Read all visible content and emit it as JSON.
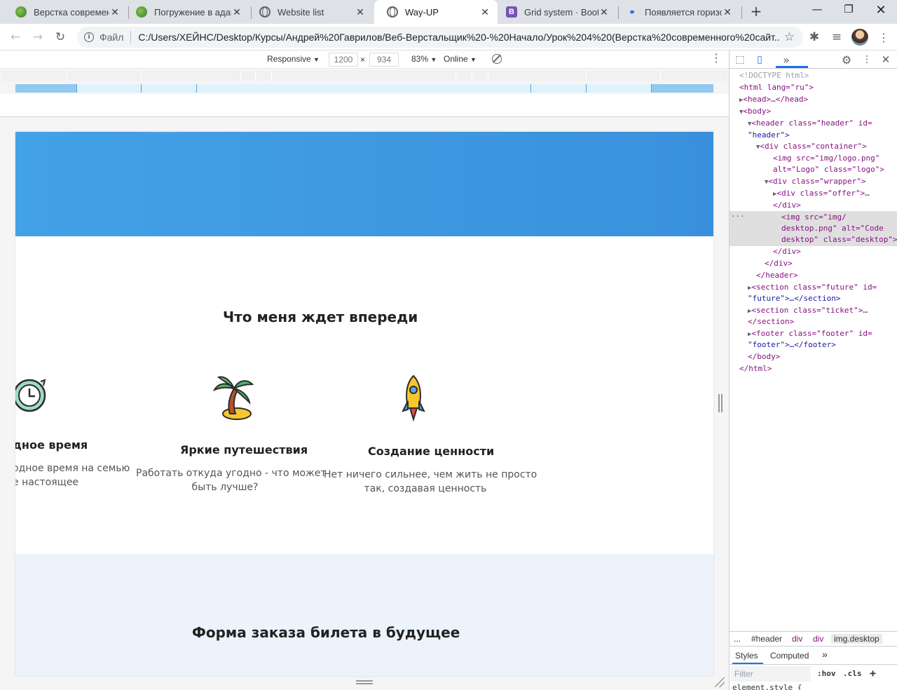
{
  "tabs": [
    {
      "title": "Верстка современн",
      "icon": "leaf-icon"
    },
    {
      "title": "Погружение в адап",
      "icon": "leaf-icon"
    },
    {
      "title": "Website list",
      "icon": "globe-icon"
    },
    {
      "title": "Way-UP",
      "icon": "globe-icon",
      "active": true
    },
    {
      "title": "Grid system · Bootstr",
      "icon": "bootstrap-icon"
    },
    {
      "title": "Появляется горизон",
      "icon": "nodes-icon"
    }
  ],
  "omnibox": {
    "scheme": "Файл",
    "url": "C:/Users/ХЕЙНС/Desktop/Курсы/Андрей%20Гаврилов/Веб-Верстальщик%20-%20Начало/Урок%204%20(Верстка%20современного%20сайт..."
  },
  "device_toolbar": {
    "mode": "Responsive",
    "width": "1200",
    "height": "934",
    "times": "×",
    "zoom": "83%",
    "throttle": "Online"
  },
  "page": {
    "future_title": "Что меня ждет впереди",
    "features": [
      {
        "title": "дное время",
        "text1": "одное время на семью",
        "text2": "е настоящее",
        "icon": "clock-icon"
      },
      {
        "title": "Яркие путешествия",
        "text1": "Работать откуда угодно - что может",
        "text2": "быть лучше?",
        "icon": "palm-island-icon"
      },
      {
        "title": "Создание ценности",
        "text1": "Нет ничего сильнее, чем жить не просто",
        "text2": "так, создавая ценность",
        "icon": "rocket-icon"
      }
    ],
    "ticket_title": "Форма заказа билета в будущее"
  },
  "devtools": {
    "lines": {
      "doctype": "<!DOCTYPE html>",
      "html_open": "<html lang=\"ru\">",
      "head": "<head>…</head>",
      "body_open": "<body>",
      "header_open_1": "<header class=\"header\" id=",
      "header_open_2": "\"header\">",
      "container_open": "<div class=\"container\">",
      "logo_1": "<img src=\"img/logo.png\"",
      "logo_2": "alt=\"Logo\" class=\"logo\">",
      "wrapper_open": "<div class=\"wrapper\">",
      "offer": "<div class=\"offer\">…",
      "div_close_1": "</div>",
      "desktop_1": "<img src=\"img/",
      "desktop_2": "desktop.png\" alt=\"Code",
      "desktop_3": "desktop\" class=\"desktop\">",
      "div_close_2": "</div>",
      "div_close_3": "</div>",
      "header_close": "</header>",
      "future_1": "<section class=\"future\" id=",
      "future_2": "\"future\">…</section>",
      "ticket_1": "<section class=\"ticket\">…",
      "ticket_2": "</section>",
      "footer_1": "<footer class=\"footer\" id=",
      "footer_2": "\"footer\">…</footer>",
      "body_close": "</body>",
      "html_close": "</html>"
    },
    "breadcrumbs": [
      "...",
      "#header",
      "div",
      "div",
      "img.desktop"
    ],
    "styles_tabs": [
      "Styles",
      "Computed",
      "»"
    ],
    "filter_placeholder": "Filter",
    "hov": ":hov",
    "cls": ".cls",
    "plus": "+",
    "element_style": "element.style {"
  },
  "colors": {
    "hero_blue": "#3a90dc",
    "ticket_bg": "#ecf3fa",
    "accent": "#1a73e8"
  }
}
